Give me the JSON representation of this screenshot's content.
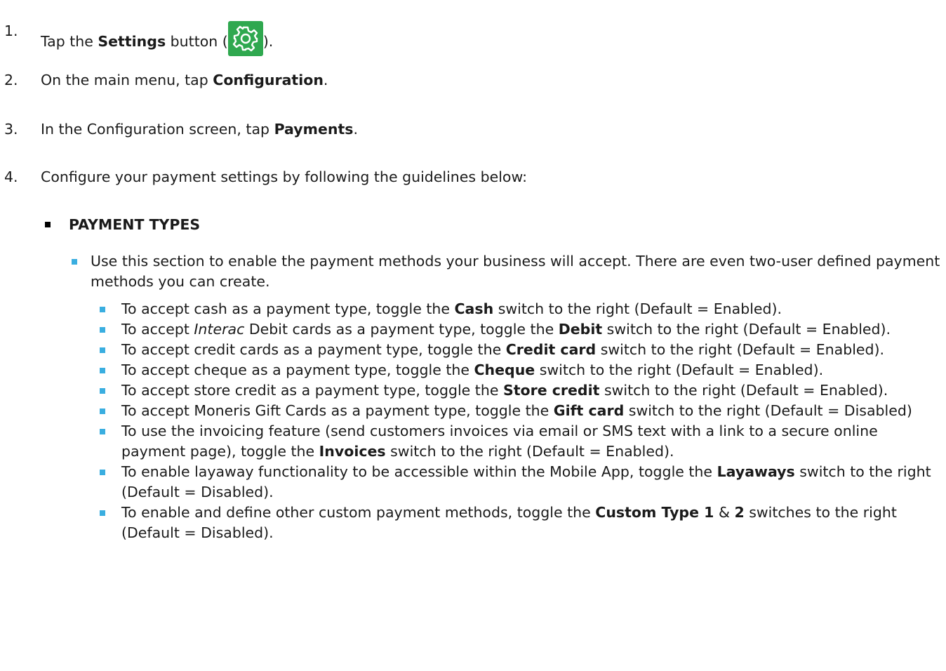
{
  "colors": {
    "gear_bg": "#2fa84f",
    "bullet": "#3aaee0"
  },
  "steps": [
    {
      "num": "1.",
      "pre": "Tap the ",
      "bold": "Settings",
      "post": " button (",
      "icon": "settings-gear-icon",
      "end": ")."
    },
    {
      "num": "2.",
      "pre": "On the main menu, tap ",
      "bold": "Configuration",
      "post": "."
    },
    {
      "num": "3.",
      "pre": "In the Configuration screen, tap ",
      "bold": "Payments",
      "post": "."
    },
    {
      "num": "4.",
      "text": "Configure your payment settings by following the guidelines below:"
    }
  ],
  "section": {
    "title": "PAYMENT TYPES"
  },
  "intro": "Use this section to enable the payment methods your business will accept. There are even two-user defined payment methods you can create.",
  "items": [
    {
      "pre": "To accept cash as a payment type, toggle the ",
      "bold": "Cash",
      "post": " switch to the right (Default = Enabled)."
    },
    {
      "pre": "To accept ",
      "italic": "Interac",
      "mid": " Debit cards as a payment type, toggle the ",
      "bold": "Debit",
      "post": " switch to the right (Default = Enabled)."
    },
    {
      "pre": "To accept credit cards as a payment type, toggle the ",
      "bold": "Credit card",
      "post": " switch to the right (Default = Enabled)."
    },
    {
      "pre": "To accept cheque as a payment type, toggle the ",
      "bold": "Cheque",
      "post": " switch to the right (Default = Enabled)."
    },
    {
      "pre": "To accept store credit as a payment type, toggle the ",
      "bold": "Store credit",
      "post": " switch to the right (Default = Enabled)."
    },
    {
      "pre": "To accept Moneris Gift Cards as a payment type, toggle the ",
      "bold": "Gift card",
      "post": " switch to the right (Default = Disabled)"
    },
    {
      "pre": "To use the invoicing feature (send customers invoices via email or SMS text with a link to a secure online payment page), toggle the ",
      "bold": "Invoices",
      "post": " switch to the right (Default = Enabled)."
    },
    {
      "pre": "To enable layaway functionality to be accessible within the Mobile App, toggle the ",
      "bold": "Layaways",
      "post": " switch to the right (Default = Disabled)."
    },
    {
      "pre": "To enable and define other custom payment methods, toggle the ",
      "bold": "Custom Type 1",
      "mid2": " & ",
      "bold2": "2",
      "post": " switches to the right (Default = Disabled)."
    }
  ]
}
